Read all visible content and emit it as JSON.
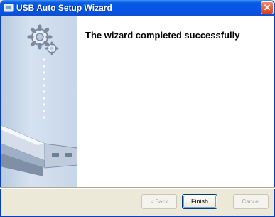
{
  "window": {
    "title": "USB Auto Setup Wizard"
  },
  "content": {
    "heading": "The wizard completed successfully"
  },
  "buttons": {
    "back": "< Back",
    "finish": "Finish",
    "cancel": "Cancel"
  }
}
